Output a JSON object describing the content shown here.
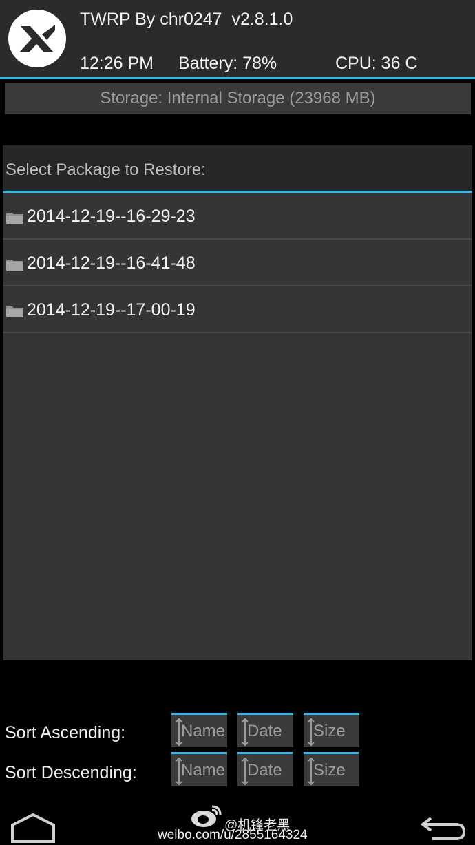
{
  "header": {
    "title": "TWRP By chr0247  v2.8.1.0",
    "time": "12:26 PM",
    "battery": "Battery: 78%",
    "cpu": "CPU: 36 C",
    "logo_icon": "twrp-logo-icon"
  },
  "storage": {
    "label": "Storage: Internal Storage (23968 MB)"
  },
  "file_list": {
    "title": "Select Package to Restore:",
    "items": [
      {
        "name": "2014-12-19--16-29-23",
        "icon": "folder-icon"
      },
      {
        "name": "2014-12-19--16-41-48",
        "icon": "folder-icon"
      },
      {
        "name": "2014-12-19--17-00-19",
        "icon": "folder-icon"
      }
    ]
  },
  "sort": {
    "ascending_label": "Sort Ascending:",
    "descending_label": "Sort Descending:",
    "buttons": [
      "Name",
      "Date",
      "Size"
    ]
  },
  "nav": {
    "home_icon": "home-icon",
    "back_icon": "back-icon"
  },
  "watermark": {
    "handle": "@机锋老黑",
    "url": "weibo.com/u/2855164324"
  },
  "colors": {
    "accent": "#33b5e5",
    "header_bg": "#2b2b2b",
    "panel_bg": "#353535",
    "button_bg": "#3a3a3a"
  }
}
